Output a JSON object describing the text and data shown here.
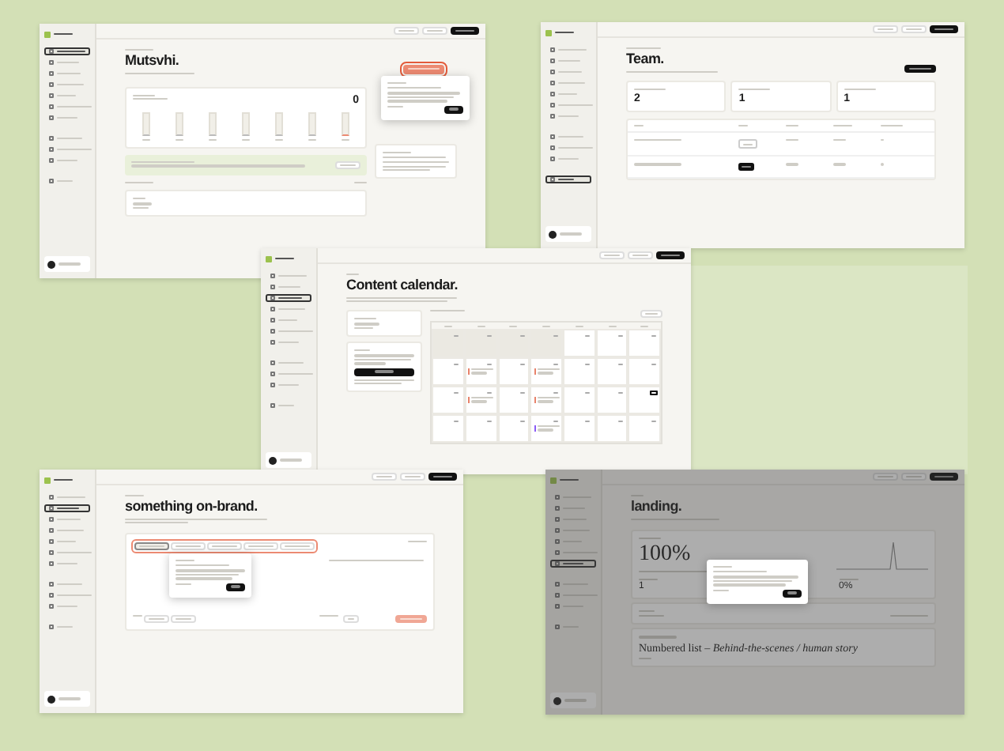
{
  "windows": [
    {
      "kind": "dashboard",
      "nav": [
        {
          "selected": true
        },
        {
          "selected": false
        },
        {
          "selected": false
        },
        {
          "selected": false
        },
        {
          "selected": false
        },
        {
          "selected": false
        },
        {
          "selected": false
        },
        {
          "selected": false
        },
        {
          "selected": false
        },
        {
          "selected": false
        },
        {
          "selected": false
        }
      ],
      "title": "Mutsvhi.",
      "sessions": {
        "value": "0",
        "days": [
          {
            "today": false
          },
          {
            "today": false
          },
          {
            "today": false
          },
          {
            "today": false
          },
          {
            "today": false
          },
          {
            "today": false
          },
          {
            "today": true
          }
        ]
      }
    },
    {
      "kind": "team",
      "nav": [
        {
          "selected": false
        },
        {
          "selected": false
        },
        {
          "selected": false
        },
        {
          "selected": false
        },
        {
          "selected": false
        },
        {
          "selected": false
        },
        {
          "selected": false
        },
        {
          "selected": false
        },
        {
          "selected": false
        },
        {
          "selected": false
        },
        {
          "selected": true
        }
      ],
      "title": "Team.",
      "stats": [
        "2",
        "1",
        "1"
      ],
      "rows": [
        {
          "admin": false
        },
        {
          "admin": true
        }
      ]
    },
    {
      "kind": "calendar",
      "nav": [
        {
          "selected": false
        },
        {
          "selected": false
        },
        {
          "selected": true
        },
        {
          "selected": false
        },
        {
          "selected": false
        },
        {
          "selected": false
        },
        {
          "selected": false
        },
        {
          "selected": false
        },
        {
          "selected": false
        },
        {
          "selected": false
        },
        {
          "selected": false
        }
      ],
      "title": "Content calendar.",
      "days": [
        {
          "muted": true,
          "today": false
        },
        {
          "muted": true,
          "today": false
        },
        {
          "muted": true,
          "today": false
        },
        {
          "muted": true,
          "today": false
        },
        {
          "muted": false,
          "today": false
        },
        {
          "muted": false,
          "today": false
        },
        {
          "muted": false,
          "today": false
        },
        {
          "muted": false,
          "today": false
        },
        {
          "muted": false,
          "today": false,
          "events": [
            {
              "color": "#e8836b"
            }
          ]
        },
        {
          "muted": false,
          "today": false
        },
        {
          "muted": false,
          "today": false,
          "events": [
            {
              "color": "#e8836b"
            }
          ]
        },
        {
          "muted": false,
          "today": false
        },
        {
          "muted": false,
          "today": false
        },
        {
          "muted": false,
          "today": false
        },
        {
          "muted": false,
          "today": false
        },
        {
          "muted": false,
          "today": false,
          "events": [
            {
              "color": "#e8836b"
            }
          ]
        },
        {
          "muted": false,
          "today": false
        },
        {
          "muted": false,
          "today": false,
          "events": [
            {
              "color": "#e8836b"
            }
          ]
        },
        {
          "muted": false,
          "today": false
        },
        {
          "muted": false,
          "today": false
        },
        {
          "muted": false,
          "today": true
        },
        {
          "muted": false,
          "today": false
        },
        {
          "muted": false,
          "today": false
        },
        {
          "muted": false,
          "today": false
        },
        {
          "muted": false,
          "today": false,
          "events": [
            {
              "color": "#8b5cf6"
            }
          ]
        },
        {
          "muted": false,
          "today": false
        },
        {
          "muted": false,
          "today": false
        },
        {
          "muted": false,
          "today": false
        }
      ]
    },
    {
      "kind": "session",
      "nav": [
        {
          "selected": false
        },
        {
          "selected": true
        },
        {
          "selected": false
        },
        {
          "selected": false
        },
        {
          "selected": false
        },
        {
          "selected": false
        },
        {
          "selected": false
        },
        {
          "selected": false
        },
        {
          "selected": false
        },
        {
          "selected": false
        },
        {
          "selected": false
        }
      ],
      "title": "something on-brand.",
      "platforms": [
        {
          "selected": true
        },
        {
          "selected": false
        },
        {
          "selected": false
        },
        {
          "selected": false
        },
        {
          "selected": false
        }
      ]
    },
    {
      "kind": "insights",
      "nav": [
        {
          "selected": false
        },
        {
          "selected": false
        },
        {
          "selected": false
        },
        {
          "selected": false
        },
        {
          "selected": false
        },
        {
          "selected": false
        },
        {
          "selected": true
        },
        {
          "selected": false
        },
        {
          "selected": false
        },
        {
          "selected": false
        },
        {
          "selected": false
        }
      ],
      "title": "landing.",
      "rate": "100%",
      "stats": [
        "1",
        "0%"
      ],
      "best": "Numbered list – *Behind-the-scenes / human story*"
    }
  ]
}
